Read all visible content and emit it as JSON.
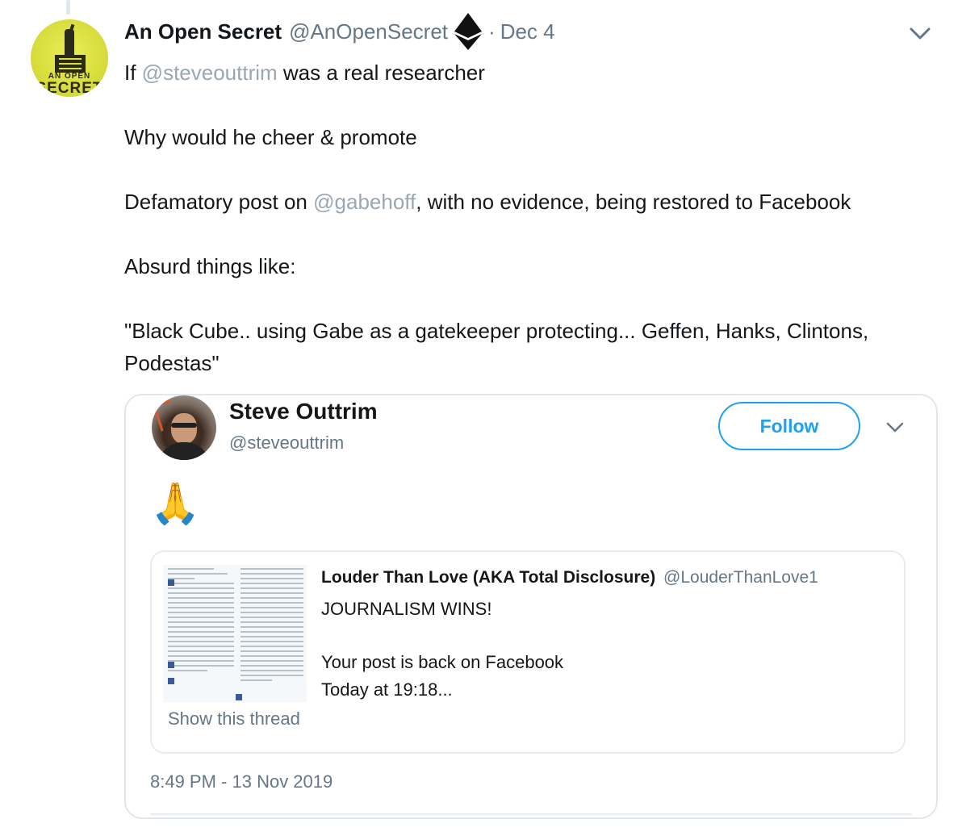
{
  "tweet": {
    "author_name": "An Open Secret",
    "author_handle": "@AnOpenSecret",
    "author_badge_icon": "ethereum-icon",
    "separator": "·",
    "date": "Dec 4",
    "avatar": {
      "line1": "AN OPEN",
      "line2": "SECRET",
      "bg_color": "#d9df3e"
    },
    "text": {
      "line1_before": "If ",
      "line1_mention": "@steveouttrim",
      "line1_after": " was a real researcher",
      "line2": "Why would he cheer & promote",
      "line3_before": "Defamatory post on ",
      "line3_mention": "@gabehoff",
      "line3_after": ", with no evidence, being restored to Facebook",
      "line4": "Absurd things like:",
      "line5": "\"Black Cube.. using Gabe as a gatekeeper protecting... Geffen, Hanks, Clintons, Podestas\""
    }
  },
  "embedded": {
    "author_name": "Steve Outtrim",
    "author_handle": "@steveouttrim",
    "follow_label": "Follow",
    "emoji": "🙏",
    "timestamp": "8:49 PM - 13 Nov 2019",
    "quote": {
      "author_name": "Louder Than Love (AKA Total Disclosure)",
      "author_handle": "@LouderThanLove1",
      "line1": "JOURNALISM WINS!",
      "line2": "Your post is back on Facebook",
      "line3": "Today at 19:18...",
      "show_thread": "Show this thread"
    }
  },
  "colors": {
    "accent": "#1da1f2",
    "text": "#14171a",
    "secondary": "#657786",
    "mention": "#9aa6b0",
    "border": "#e1e8ed"
  }
}
